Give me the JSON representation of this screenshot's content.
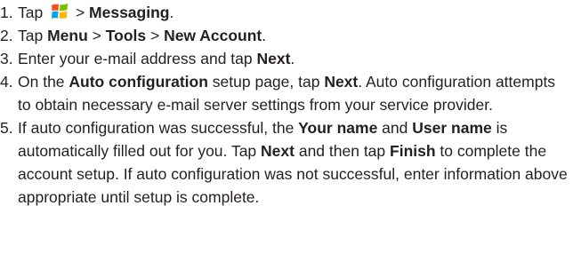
{
  "steps": [
    {
      "num": "1.",
      "segments": [
        {
          "t": "Tap "
        },
        {
          "icon": "windows-start-icon"
        },
        {
          "t": " > "
        },
        {
          "t": "Messaging",
          "b": true
        },
        {
          "t": "."
        }
      ]
    },
    {
      "num": "2.",
      "segments": [
        {
          "t": "Tap "
        },
        {
          "t": "Menu",
          "b": true
        },
        {
          "t": " > "
        },
        {
          "t": "Tools",
          "b": true
        },
        {
          "t": " > "
        },
        {
          "t": "New Account",
          "b": true
        },
        {
          "t": "."
        }
      ]
    },
    {
      "num": "3.",
      "segments": [
        {
          "t": "Enter your e-mail address and tap "
        },
        {
          "t": "Next",
          "b": true
        },
        {
          "t": "."
        }
      ]
    },
    {
      "num": "4.",
      "segments": [
        {
          "t": "On the "
        },
        {
          "t": "Auto configuration",
          "b": true
        },
        {
          "t": " setup page, tap "
        },
        {
          "t": "Next",
          "b": true
        },
        {
          "t": ". Auto configuration attempts to obtain necessary e-mail server settings from your service provider."
        }
      ]
    },
    {
      "num": "5.",
      "segments": [
        {
          "t": "If auto configuration was successful, the "
        },
        {
          "t": "Your name",
          "b": true
        },
        {
          "t": " and "
        },
        {
          "t": "User name",
          "b": true
        },
        {
          "t": " is automatically filled out for you. Tap "
        },
        {
          "t": "Next",
          "b": true
        },
        {
          "t": " and then tap "
        },
        {
          "t": "Finish",
          "b": true
        },
        {
          "t": " to complete the account setup. If auto configuration was not successful, enter information above appropriate until setup is complete."
        }
      ]
    }
  ]
}
